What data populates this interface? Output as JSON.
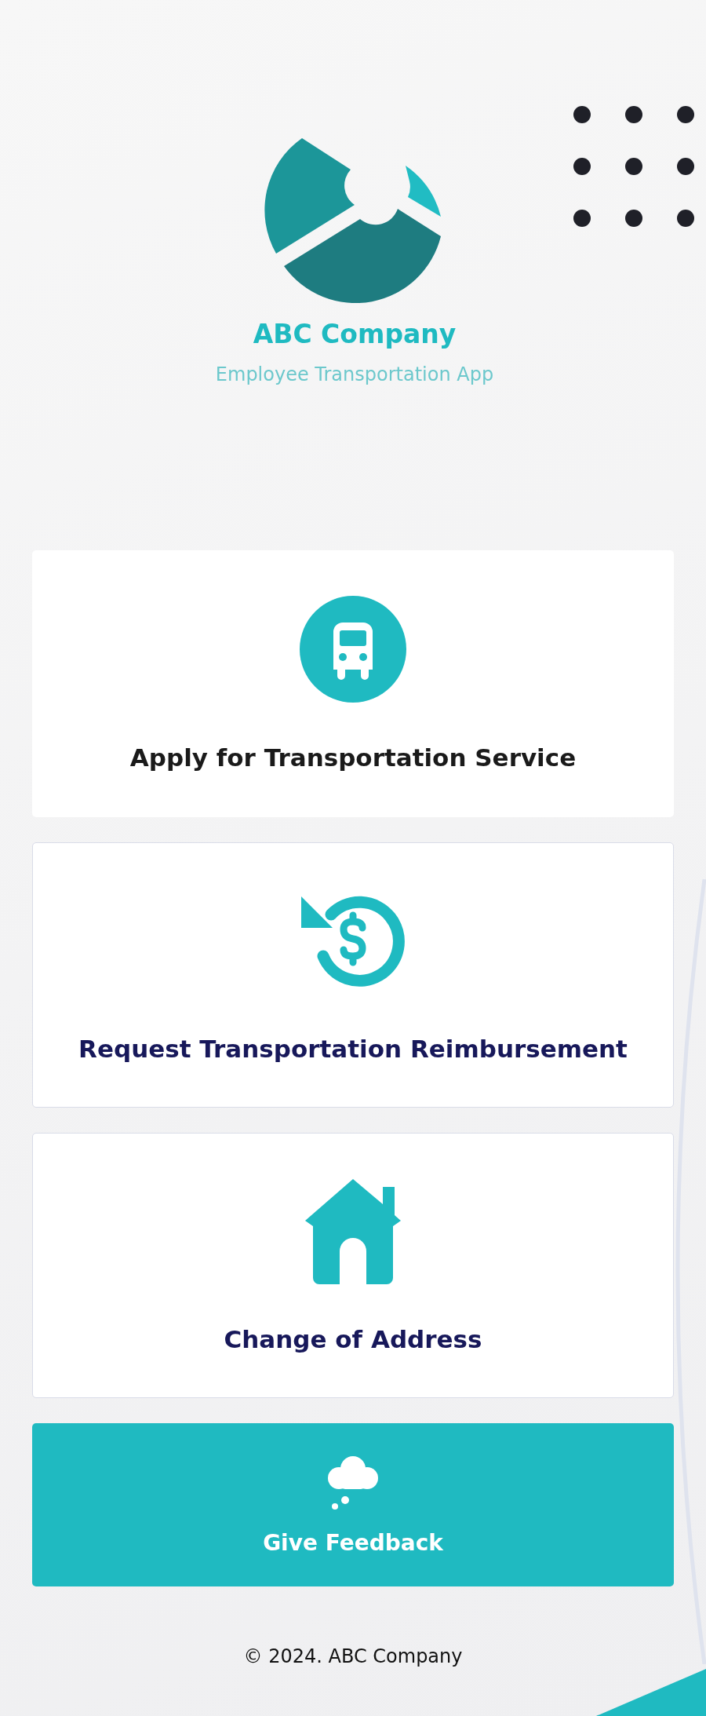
{
  "header": {
    "company": "ABC Company",
    "subtitle": "Employee Transportation App"
  },
  "cards": [
    {
      "kind": "plain",
      "label": "Apply for Transportation Service"
    },
    {
      "kind": "outlined",
      "label": "Request Transportation Reimbursement"
    },
    {
      "kind": "outlined",
      "label": "Change of Address"
    },
    {
      "kind": "filled",
      "label": "Give Feedback"
    }
  ],
  "footer": "© 2024. ABC Company"
}
